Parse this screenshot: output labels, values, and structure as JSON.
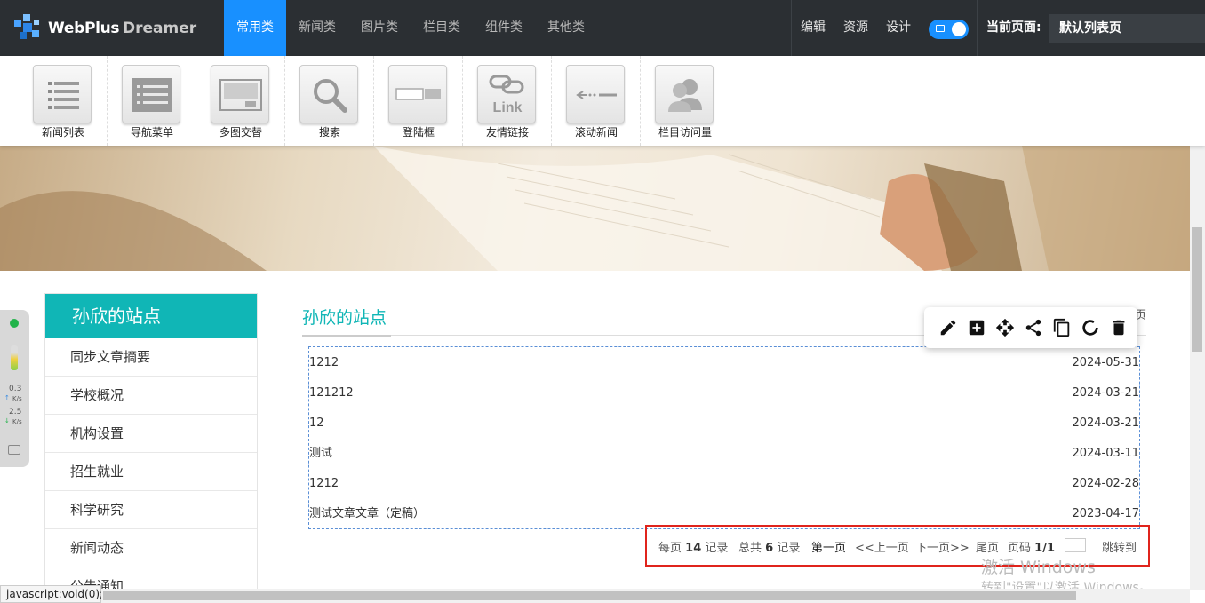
{
  "app": {
    "brand": "WebPlus",
    "brand2": "Dreamer"
  },
  "tabs": [
    {
      "label": "常用类",
      "active": true
    },
    {
      "label": "新闻类"
    },
    {
      "label": "图片类"
    },
    {
      "label": "栏目类"
    },
    {
      "label": "组件类"
    },
    {
      "label": "其他类"
    }
  ],
  "right_menu": {
    "edit": "编辑",
    "resources": "资源",
    "design": "设计"
  },
  "current_page": {
    "label": "当前页面:",
    "value": "默认列表页"
  },
  "tools": [
    {
      "label": "新闻列表",
      "icon": "news-list-icon"
    },
    {
      "label": "导航菜单",
      "icon": "nav-menu-icon"
    },
    {
      "label": "多图交替",
      "icon": "multi-image-icon"
    },
    {
      "label": "搜索",
      "icon": "search-icon"
    },
    {
      "label": "登陆框",
      "icon": "login-box-icon"
    },
    {
      "label": "友情链接",
      "icon": "link-icon"
    },
    {
      "label": "滚动新闻",
      "icon": "scroll-news-icon"
    },
    {
      "label": "栏目访问量",
      "icon": "visits-icon"
    }
  ],
  "sidebar": {
    "title": "孙欣的站点",
    "items": [
      "同步文章摘要",
      "学校概况",
      "机构设置",
      "招生就业",
      "科学研究",
      "新闻动态",
      "公告通知"
    ]
  },
  "main": {
    "title": "孙欣的站点",
    "more": "页",
    "rows": [
      {
        "title": "1212",
        "date": "2024-05-31"
      },
      {
        "title": "121212",
        "date": "2024-03-21"
      },
      {
        "title": "12",
        "date": "2024-03-21"
      },
      {
        "title": "测试",
        "date": "2024-03-11"
      },
      {
        "title": "1212",
        "date": "2024-02-28"
      },
      {
        "title": "测试文章文章（定稿）",
        "date": "2023-04-17"
      }
    ]
  },
  "pager": {
    "per_page_prefix": "每页",
    "per_page": "14",
    "per_page_suffix": "记录",
    "total_prefix": "总共",
    "total": "6",
    "total_suffix": "记录",
    "first": "第一页",
    "prev": "<<上一页",
    "next": "下一页>>",
    "last": "尾页",
    "page_label": "页码",
    "page_value": "1/1",
    "jump": "跳转到"
  },
  "speed_widget": {
    "up": "0.3",
    "up_unit": "K/s",
    "down": "2.5",
    "down_unit": "K/s"
  },
  "watermark": {
    "line1": "激活 Windows",
    "line2": "转到\"设置\"以激活 Windows。"
  },
  "status_bar": "javascript:void(0);",
  "colors": {
    "accent": "#1890ff",
    "teal": "#10b6b6",
    "topbar": "#2b2f33",
    "pager_border": "#e0241c"
  }
}
